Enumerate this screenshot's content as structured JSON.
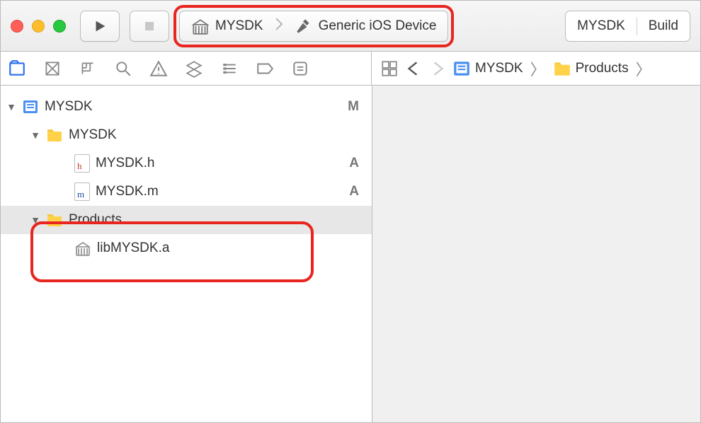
{
  "toolbar": {
    "scheme": {
      "target": "MYSDK",
      "destination": "Generic iOS Device"
    },
    "activity": {
      "primary": "MYSDK",
      "secondary": "Build"
    }
  },
  "jumpbar": {
    "project": "MYSDK",
    "folder": "Products"
  },
  "tree": {
    "root": {
      "name": "MYSDK",
      "status": "M",
      "children": [
        {
          "name": "MYSDK",
          "type": "folder",
          "children": [
            {
              "name": "MYSDK.h",
              "type": "header",
              "status": "A"
            },
            {
              "name": "MYSDK.m",
              "type": "impl",
              "status": "A"
            }
          ]
        },
        {
          "name": "Products",
          "type": "folder",
          "selected": true,
          "children": [
            {
              "name": "libMYSDK.a",
              "type": "lib"
            }
          ]
        }
      ]
    }
  },
  "colors": {
    "accent": "#2a6fee",
    "highlight": "#e8251f"
  }
}
